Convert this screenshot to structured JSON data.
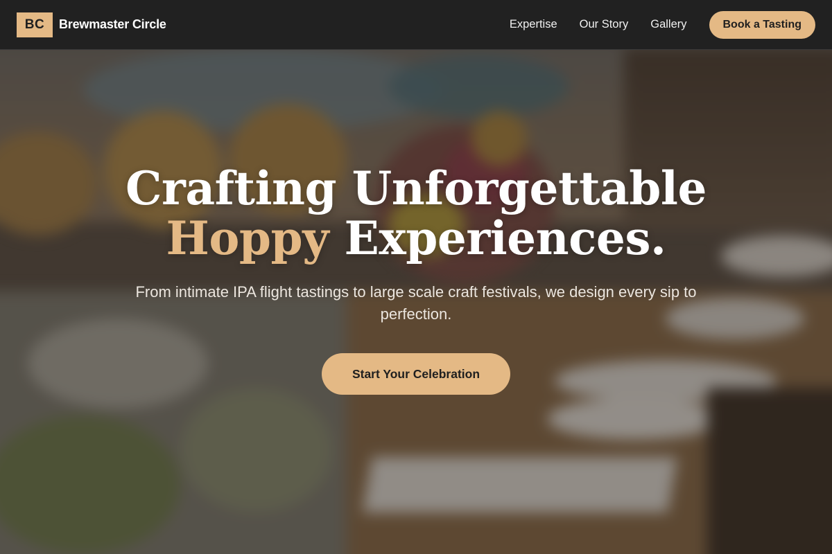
{
  "brand": {
    "logo_initials": "BC",
    "name": "Brewmaster Circle"
  },
  "nav": {
    "links": [
      {
        "label": "Expertise"
      },
      {
        "label": "Our Story"
      },
      {
        "label": "Gallery"
      }
    ],
    "cta_label": "Book a Tasting"
  },
  "hero": {
    "title_line1": "Crafting Unforgettable",
    "title_accent": "Hoppy",
    "title_line2_rest": " Experiences.",
    "subtitle": "From intimate IPA flight tastings to large scale craft festivals, we design every sip to perfection.",
    "cta_label": "Start Your Celebration",
    "background_image": "banquet-table-photo"
  },
  "colors": {
    "accent": "#e4b985",
    "navbar": "#212121",
    "text_light": "#ffffff"
  }
}
